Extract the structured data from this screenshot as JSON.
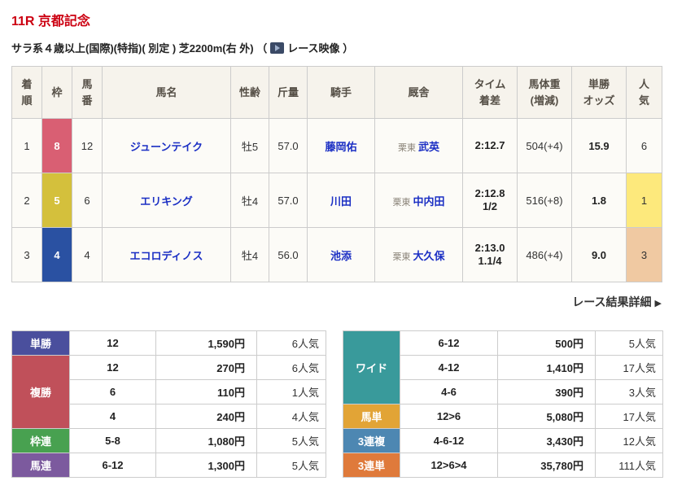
{
  "colors": {
    "title_red": "#cc0011",
    "link_blue": "#1b2fc4",
    "header_bg": "#f6f3ec",
    "row_bg": "#fcfbf7",
    "border": "#cccccc"
  },
  "header": {
    "title": "11R 京都記念",
    "conditions": "サラ系４歳以上(国際)(特指)( 別定 ) 芝2200m(右 外)",
    "paren_open": "（",
    "video_label": "レース映像",
    "paren_close": "）"
  },
  "results": {
    "headers": [
      {
        "line1": "着",
        "line2": "順"
      },
      {
        "line1": "枠",
        "line2": ""
      },
      {
        "line1": "馬",
        "line2": "番"
      },
      {
        "line1": "馬名",
        "line2": ""
      },
      {
        "line1": "性齢",
        "line2": ""
      },
      {
        "line1": "斤量",
        "line2": ""
      },
      {
        "line1": "騎手",
        "line2": ""
      },
      {
        "line1": "厩舎",
        "line2": ""
      },
      {
        "line1": "タイム",
        "line2": "着差"
      },
      {
        "line1": "馬体重",
        "line2": "(増減)"
      },
      {
        "line1": "単勝",
        "line2": "オッズ"
      },
      {
        "line1": "人",
        "line2": "気"
      }
    ],
    "rows": [
      {
        "pos": "1",
        "waku": "8",
        "waku_bg": "#d95f73",
        "num": "12",
        "horse": "ジューンテイク",
        "sexage": "牡5",
        "weight": "57.0",
        "jockey": "藤岡佑",
        "region": "栗東",
        "stable": "武英",
        "time": "2:12.7",
        "margin": "",
        "body": "504(+4)",
        "odds": "15.9",
        "pop": "6",
        "pop_bg": ""
      },
      {
        "pos": "2",
        "waku": "5",
        "waku_bg": "#d4c03c",
        "num": "6",
        "horse": "エリキング",
        "sexage": "牡4",
        "weight": "57.0",
        "jockey": "川田",
        "region": "栗東",
        "stable": "中内田",
        "time": "2:12.8",
        "margin": "1/2",
        "body": "516(+8)",
        "odds": "1.8",
        "pop": "1",
        "pop_bg": "#fde97c"
      },
      {
        "pos": "3",
        "waku": "4",
        "waku_bg": "#2a51a2",
        "num": "4",
        "horse": "エコロディノス",
        "sexage": "牡4",
        "weight": "56.0",
        "jockey": "池添",
        "region": "栗東",
        "stable": "大久保",
        "time": "2:13.0",
        "margin": "1.1/4",
        "body": "486(+4)",
        "odds": "9.0",
        "pop": "3",
        "pop_bg": "#f0c9a2"
      }
    ],
    "detail_link": "レース結果詳細",
    "detail_arrow": "▶"
  },
  "payouts": {
    "left": [
      {
        "label": "単勝",
        "color": "#4a4f9d",
        "entries": [
          {
            "combo": "12",
            "payout": "1,590円",
            "pop": "6人気"
          }
        ]
      },
      {
        "label": "複勝",
        "color": "#c0505a",
        "entries": [
          {
            "combo": "12",
            "payout": "270円",
            "pop": "6人気"
          },
          {
            "combo": "6",
            "payout": "110円",
            "pop": "1人気"
          },
          {
            "combo": "4",
            "payout": "240円",
            "pop": "4人気"
          }
        ]
      },
      {
        "label": "枠連",
        "color": "#48a150",
        "entries": [
          {
            "combo": "5-8",
            "payout": "1,080円",
            "pop": "5人気"
          }
        ]
      },
      {
        "label": "馬連",
        "color": "#7c5a9e",
        "entries": [
          {
            "combo": "6-12",
            "payout": "1,300円",
            "pop": "5人気"
          }
        ]
      }
    ],
    "right": [
      {
        "label": "ワイド",
        "color": "#399a9b",
        "entries": [
          {
            "combo": "6-12",
            "payout": "500円",
            "pop": "5人気"
          },
          {
            "combo": "4-12",
            "payout": "1,410円",
            "pop": "17人気"
          },
          {
            "combo": "4-6",
            "payout": "390円",
            "pop": "3人気"
          }
        ]
      },
      {
        "label": "馬単",
        "color": "#e2a436",
        "entries": [
          {
            "combo": "12>6",
            "payout": "5,080円",
            "pop": "17人気"
          }
        ]
      },
      {
        "label": "3連複",
        "color": "#4d87b2",
        "entries": [
          {
            "combo": "4-6-12",
            "payout": "3,430円",
            "pop": "12人気"
          }
        ]
      },
      {
        "label": "3連単",
        "color": "#df7a3b",
        "entries": [
          {
            "combo": "12>6>4",
            "payout": "35,780円",
            "pop": "111人気"
          }
        ]
      }
    ]
  }
}
